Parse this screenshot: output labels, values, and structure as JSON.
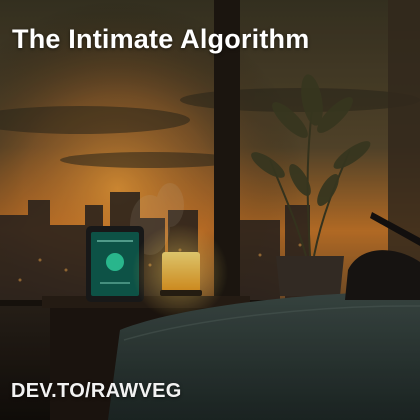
{
  "overlay": {
    "title": "The Intimate Algorithm",
    "footer": "DEV.TO/RAWVEG"
  },
  "colors": {
    "sky_top": "#3a3422",
    "sunset_glow": "#e0892b",
    "window_frame": "#2a2218",
    "lamp_glow": "#f4c23a",
    "device_screen": "#0f6b5a",
    "device_circle": "#2fd0a0",
    "bed_sheet": "#2c3a38"
  }
}
